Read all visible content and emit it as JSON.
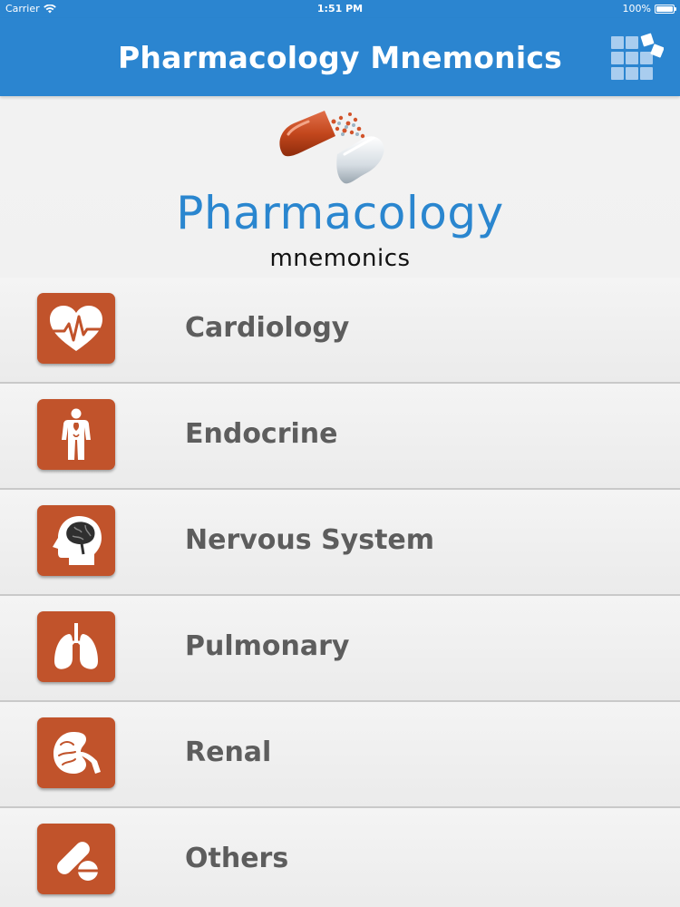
{
  "status_bar": {
    "carrier": "Carrier",
    "time": "1:51 PM",
    "battery": "100%"
  },
  "nav": {
    "title": "Pharmacology Mnemonics",
    "menu_icon": "grid-menu-icon"
  },
  "logo": {
    "title": "Pharmacology",
    "subtitle": "mnemonics",
    "icon": "capsule-icon"
  },
  "menu": {
    "items": [
      {
        "label": "Cardiology",
        "icon": "heart-icon"
      },
      {
        "label": "Endocrine",
        "icon": "human-body-icon"
      },
      {
        "label": "Nervous System",
        "icon": "brain-head-icon"
      },
      {
        "label": "Pulmonary",
        "icon": "lungs-icon"
      },
      {
        "label": "Renal",
        "icon": "kidney-icon"
      },
      {
        "label": "Others",
        "icon": "pill-icon"
      }
    ]
  },
  "colors": {
    "nav_blue": "#2b85d0",
    "icon_orange": "#c1532b",
    "label_gray": "#5d5d5d",
    "logo_blue": "#2a86cf"
  }
}
